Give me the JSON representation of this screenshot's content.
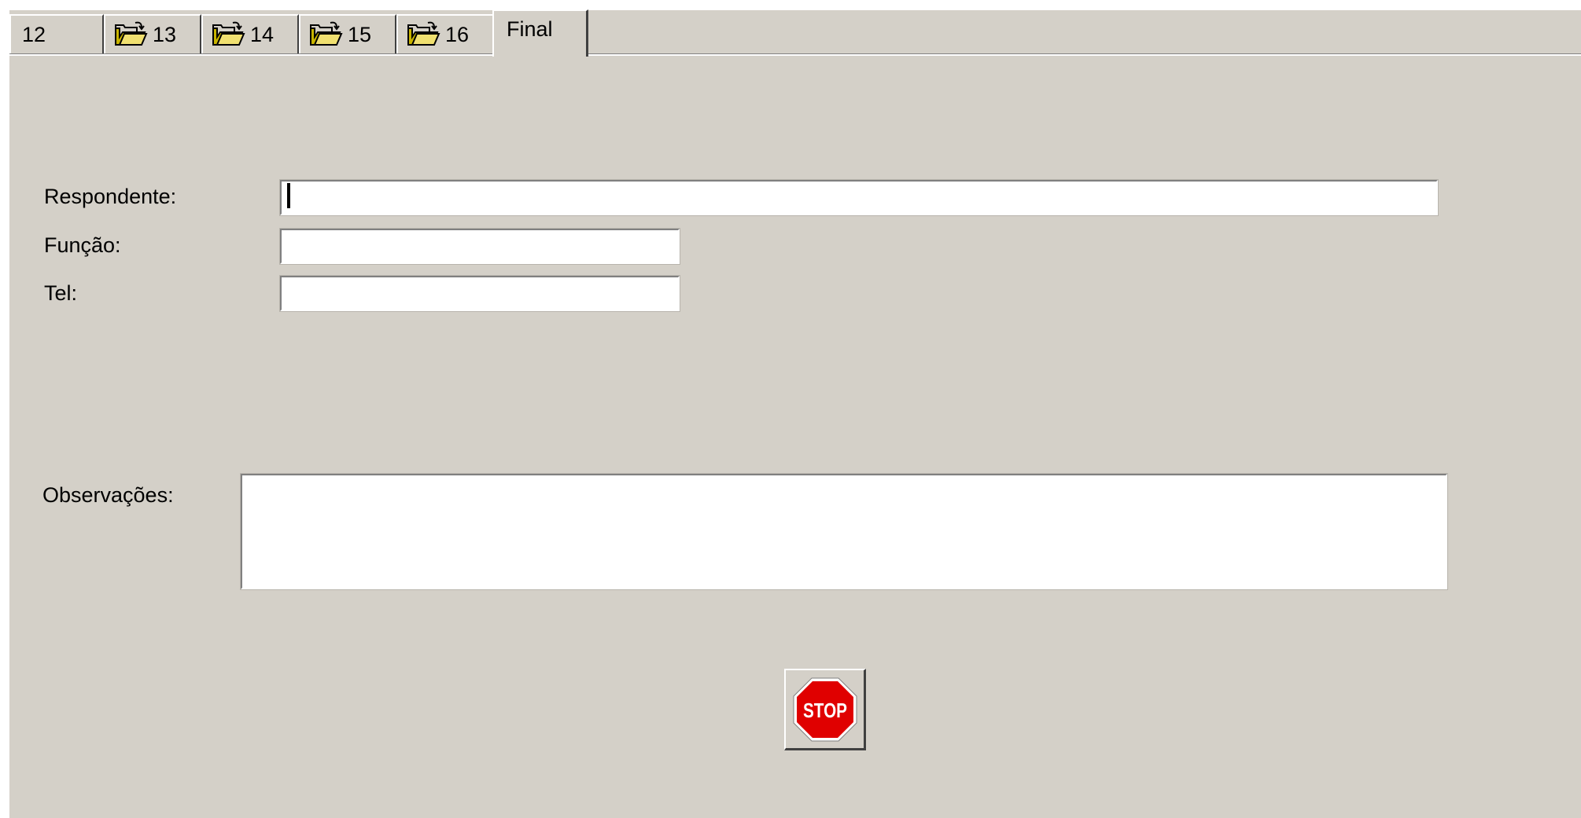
{
  "tabs": [
    {
      "label": "12",
      "icon": null,
      "active": false
    },
    {
      "label": "13",
      "icon": "folder-open-icon",
      "active": false
    },
    {
      "label": "14",
      "icon": "folder-open-icon",
      "active": false
    },
    {
      "label": "15",
      "icon": "folder-open-icon",
      "active": false
    },
    {
      "label": "16",
      "icon": "folder-open-icon",
      "active": false
    },
    {
      "label": "Final",
      "icon": null,
      "active": true
    }
  ],
  "form": {
    "respondente_label": "Respondente:",
    "respondente_value": "",
    "funcao_label": "Função:",
    "funcao_value": "",
    "tel_label": "Tel:",
    "tel_value": "",
    "observacoes_label": "Observações:",
    "observacoes_value": ""
  },
  "stop_button": {
    "text": "STOP",
    "icon": "stop-sign-icon"
  },
  "colors": {
    "window_bg": "#d4d0c8",
    "field_bg": "#ffffff",
    "stop_red": "#e00000"
  }
}
